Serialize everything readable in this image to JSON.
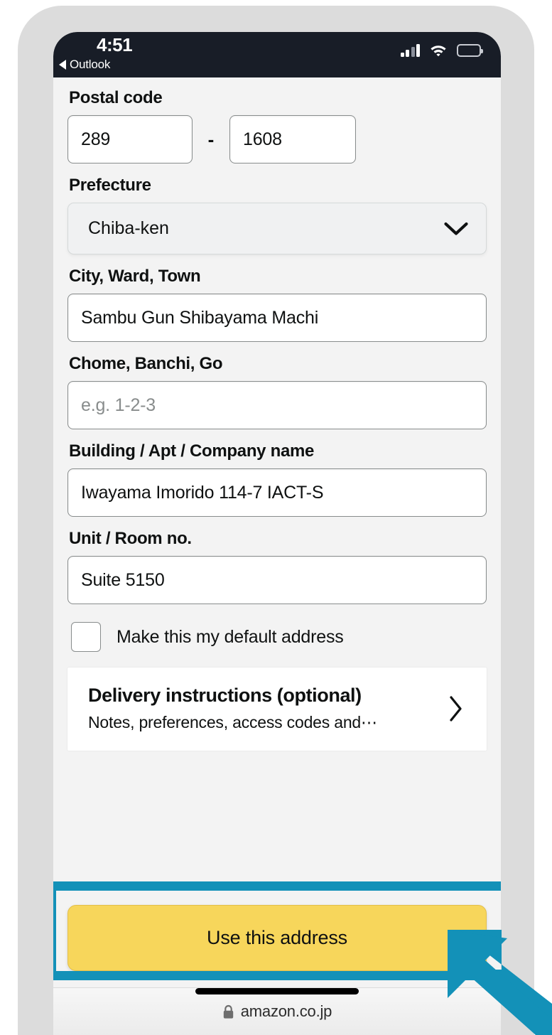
{
  "status_bar": {
    "time": "4:51",
    "back_app": "Outlook",
    "signal_icon": "cellular-signal-icon",
    "wifi_icon": "wifi-icon",
    "battery_icon": "battery-icon"
  },
  "form": {
    "postal_code": {
      "label": "Postal code",
      "part1_value": "289",
      "separator": "-",
      "part2_value": "1608"
    },
    "prefecture": {
      "label": "Prefecture",
      "selected": "Chiba-ken",
      "chevron_icon": "chevron-down-icon"
    },
    "city": {
      "label": "City, Ward, Town",
      "value": "Sambu Gun Shibayama Machi",
      "placeholder": ""
    },
    "chome": {
      "label": "Chome, Banchi, Go",
      "value": "",
      "placeholder": "e.g. 1-2-3"
    },
    "building": {
      "label": "Building / Apt / Company name",
      "value": "Iwayama Imorido 114-7 IACT-S",
      "placeholder": ""
    },
    "unit": {
      "label": "Unit / Room no.",
      "value": "Suite 5150",
      "placeholder": ""
    },
    "default_address": {
      "label": "Make this my default address",
      "checked": false
    },
    "delivery_instructions": {
      "title": "Delivery instructions (optional)",
      "subtitle": "Notes, preferences, access codes and⋯",
      "chevron_icon": "chevron-right-icon"
    },
    "submit": {
      "label": "Use this address"
    }
  },
  "browser_bar": {
    "lock_icon": "lock-icon",
    "domain": "amazon.co.jp"
  },
  "overlay": {
    "highlight_color": "#1391b8",
    "cursor_icon": "arrow-cursor-icon"
  },
  "colors": {
    "accent_yellow": "#f7d65b",
    "highlight_blue": "#1391b8",
    "status_bar_dark": "#181d27",
    "page_background": "#f3f3f3",
    "text_primary": "#0f1111"
  }
}
